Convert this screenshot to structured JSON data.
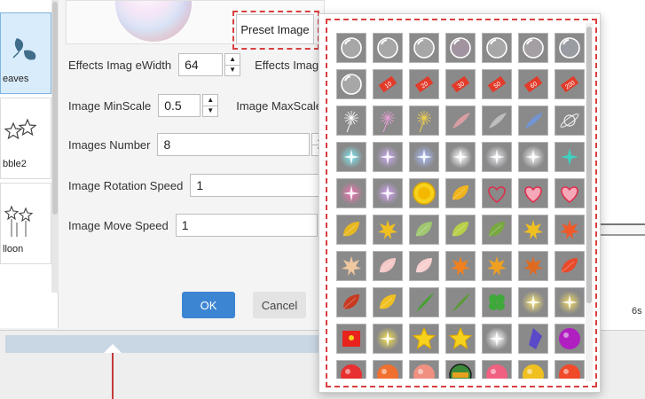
{
  "effects_list": {
    "items": [
      {
        "label": "eaves",
        "icon": "leaves-icon",
        "selected": true
      },
      {
        "label": "bble2",
        "icon": "stars-icon",
        "selected": false
      },
      {
        "label": "lloon",
        "icon": "balloon-stars-icon",
        "selected": false
      }
    ]
  },
  "preview": {
    "preset_button_label": "Preset Image"
  },
  "form": {
    "effects_image_width": {
      "label": "Effects Imag eWidth",
      "value": "64"
    },
    "effects_image_height_label": "Effects Image",
    "image_min_scale": {
      "label": "Image MinScale",
      "value": "0.5"
    },
    "image_max_scale_label": "Image MaxScale",
    "images_number": {
      "label": "Images Number",
      "value": "8"
    },
    "image_rotation_speed": {
      "label": "Image Rotation Speed",
      "value": "1"
    },
    "image_move_speed": {
      "label": "Image Move Speed",
      "value": "1"
    }
  },
  "buttons": {
    "ok": "OK",
    "cancel": "Cancel"
  },
  "timeline": {
    "time_hint": "6s"
  },
  "preset_popup": {
    "rows": [
      [
        "ring-bubble",
        "clear-bubble",
        "glass-bubble",
        "rainbow-bubble",
        "soft-bubble",
        "shiny-bubble",
        "tint-bubble"
      ],
      [
        "faint-bubble",
        "tag-10",
        "tag-20",
        "tag-30",
        "tag-50",
        "tag-60",
        "tag-200"
      ],
      [
        "white-dandelion",
        "pink-dandelion",
        "yellow-dandelion",
        "pink-feather",
        "grey-feather",
        "blue-feather",
        "planet"
      ],
      [
        "cyan-spark",
        "violet-spark",
        "blue-spark",
        "white-glow",
        "soft-glow",
        "pale-glow",
        "teal-star"
      ],
      [
        "pink-sparkle",
        "lilac-sparkle",
        "gold-coin",
        "yellow-leaf-bird",
        "red-heart-outline",
        "pink-heart",
        "pink-doodle-heart"
      ],
      [
        "yellow-leaf",
        "yellow-maple",
        "green-leaf",
        "lime-leaf",
        "green-leaf-2",
        "ginkgo",
        "red-maple"
      ],
      [
        "beige-maple",
        "pink-petal",
        "pink-petal-2",
        "orange-maple",
        "gold-maple",
        "orange-maple-2",
        "red-oak-leaf"
      ],
      [
        "red-twig-leaf",
        "yellow-leaf-2",
        "green-blade",
        "green-blade-2",
        "clover",
        "yellow-glow",
        "yellow-glow-2"
      ],
      [
        "red-envelope",
        "gold-star-glow",
        "gold-star",
        "gold-star-badge",
        "white-sparkle",
        "blue-crystal",
        "purple-orb"
      ],
      [
        "red-ball",
        "orange-ball",
        "peach-ball",
        "basket",
        "pink-ball",
        "gold-ball",
        "red-orb"
      ]
    ],
    "colors": {
      "accent_dashed": "#d94040",
      "ok_button": "#3c85d2"
    }
  }
}
